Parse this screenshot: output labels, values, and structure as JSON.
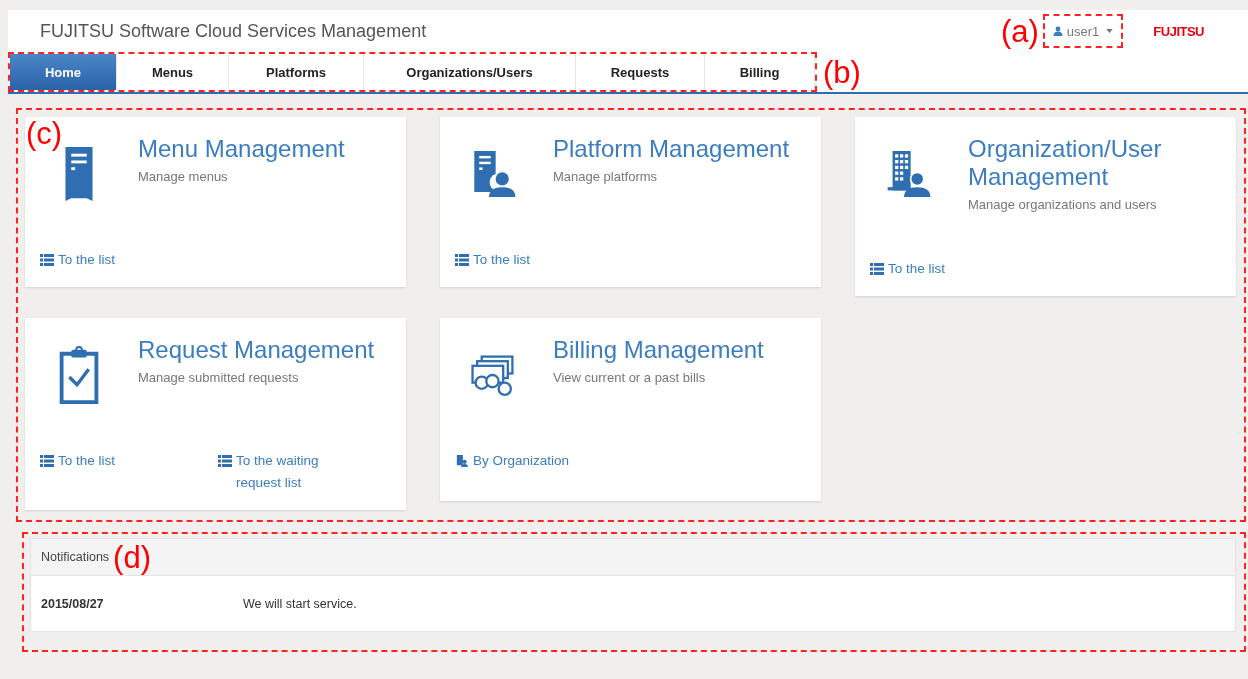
{
  "header": {
    "title": "FUJITSU Software Cloud Services Management",
    "annotation": "(a)",
    "user": {
      "name": "user1"
    },
    "logo": "FUJITSU"
  },
  "nav": {
    "annotation": "(b)",
    "tabs": [
      {
        "label": "Home",
        "selected": true
      },
      {
        "label": "Menus",
        "selected": false
      },
      {
        "label": "Platforms",
        "selected": false
      },
      {
        "label": "Organizations/Users",
        "selected": false
      },
      {
        "label": "Requests",
        "selected": false
      },
      {
        "label": "Billing",
        "selected": false
      }
    ]
  },
  "cards_section": {
    "annotation": "(c)",
    "cards": [
      {
        "kind": "server",
        "title": "Menu Management",
        "description": "Manage menus",
        "links": [
          {
            "kind": "list",
            "label": "To the list"
          }
        ]
      },
      {
        "kind": "platform",
        "title": "Platform Management",
        "description": "Manage platforms",
        "links": [
          {
            "kind": "list",
            "label": "To the list"
          }
        ]
      },
      {
        "kind": "organization",
        "title": "Organization/User Management",
        "description": "Manage organizations and users",
        "links": [
          {
            "kind": "list",
            "label": "To the list"
          }
        ]
      },
      {
        "kind": "request",
        "title": "Request Management",
        "description": "Manage submitted requests",
        "links": [
          {
            "kind": "list",
            "label": "To the list"
          },
          {
            "kind": "list",
            "label": "To the waiting request list"
          }
        ]
      },
      {
        "kind": "billing",
        "title": "Billing Management",
        "description": "View current or a past bills",
        "links": [
          {
            "kind": "organization",
            "label": "By Organization"
          }
        ]
      }
    ]
  },
  "notifications": {
    "title": "Notifications",
    "annotation": "(d)",
    "items": [
      {
        "date": "2015/08/27",
        "message": "We will start service."
      }
    ]
  }
}
